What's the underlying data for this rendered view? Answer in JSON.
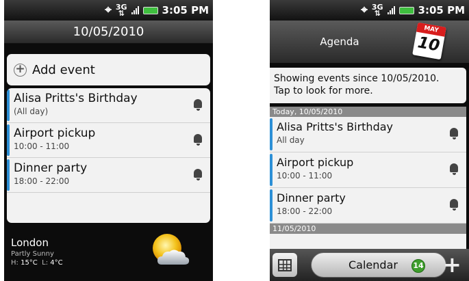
{
  "screen_left": {
    "status": {
      "net": "3G",
      "time": "3:05 PM"
    },
    "date_header": "10/05/2010",
    "add_event_label": "Add event",
    "events": [
      {
        "title": "Alisa Pritts's Birthday",
        "time": "(All day)"
      },
      {
        "title": "Airport pickup",
        "time": "10:00 - 11:00"
      },
      {
        "title": "Dinner party",
        "time": "18:00 - 22:00"
      }
    ],
    "weather": {
      "city": "London",
      "condition": "Partly Sunny",
      "high_label": "H:",
      "high": "15°C",
      "low_label": "L:",
      "low": "4°C"
    }
  },
  "screen_right": {
    "status": {
      "net": "3G",
      "time": "3:05 PM"
    },
    "title": "Agenda",
    "calendar_icon": {
      "month": "MAY",
      "day": "10"
    },
    "notice_line1": "Showing events since 10/05/2010.",
    "notice_line2": "Tap to look for more.",
    "day_header_1": "Today, 10/05/2010",
    "events": [
      {
        "title": "Alisa Pritts's Birthday",
        "time": "All day"
      },
      {
        "title": "Airport pickup",
        "time": "10:00 - 11:00"
      },
      {
        "title": "Dinner party",
        "time": "18:00 - 22:00"
      }
    ],
    "day_header_2": "11/05/2010",
    "bottom_bar": {
      "tab_label": "Calendar",
      "badge_count": "14",
      "add_symbol": "+"
    }
  },
  "colors": {
    "event_accent": "#2c8fd6",
    "badge": "#3e9e2c",
    "calendar_red": "#d81d1d"
  }
}
